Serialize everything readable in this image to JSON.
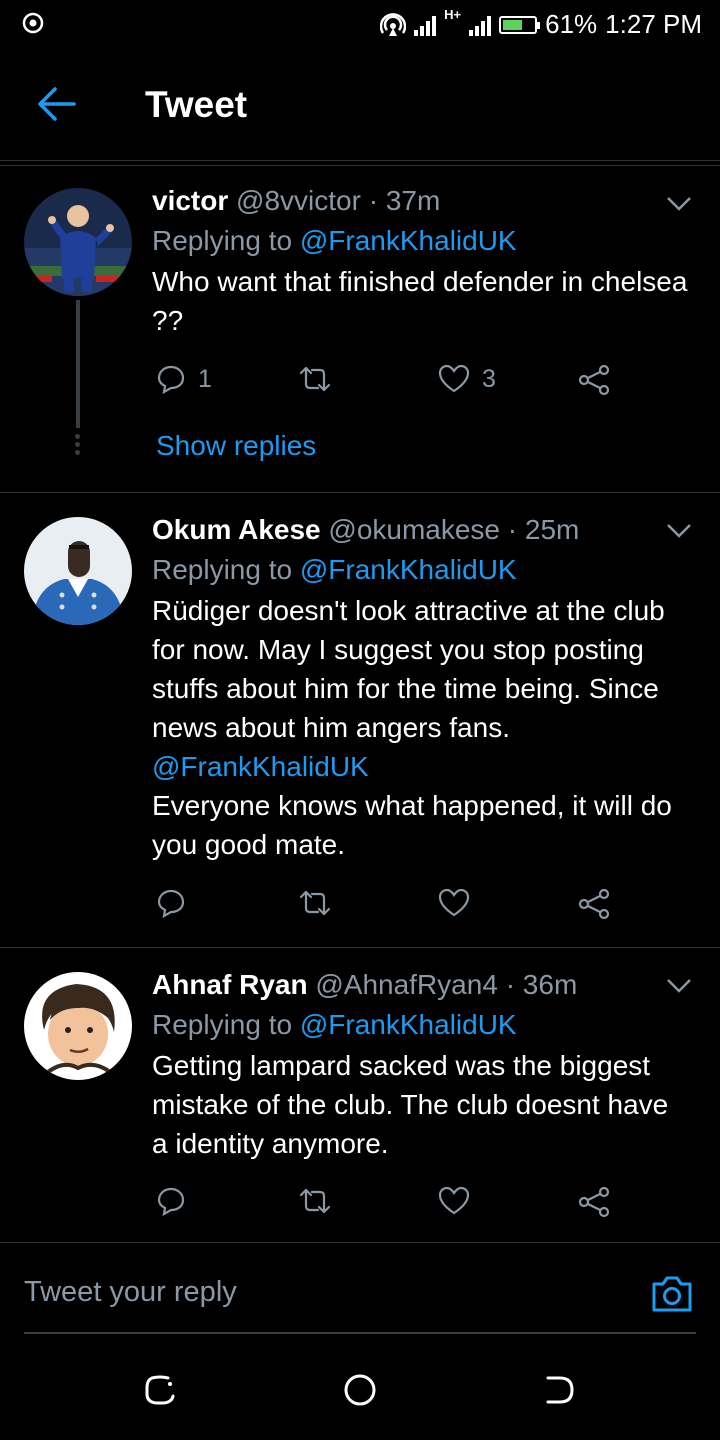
{
  "status_bar": {
    "battery": "61%",
    "time": "1:27 PM",
    "network": "H+",
    "icons": [
      "app-notification-icon",
      "hotspot-icon",
      "signal-icon",
      "battery-charging-icon"
    ]
  },
  "header": {
    "title": "Tweet",
    "back_icon": "arrow-left-icon"
  },
  "tweets": [
    {
      "name": "victor",
      "handle": "@8vvictor",
      "sep": "·",
      "time": "37m",
      "replying_prefix": "Replying to",
      "replying_to": "@FrankKhalidUK",
      "text": "Who want that finished defender in chelsea ??",
      "replies": "1",
      "retweets": "",
      "likes": "3",
      "show_replies": "Show replies"
    },
    {
      "name": "Okum Akese",
      "handle": "@okumakese",
      "sep": "·",
      "time": "25m",
      "replying_prefix": "Replying to",
      "replying_to": "@FrankKhalidUK",
      "text_part1": "Rüdiger doesn't look attractive at the club for now. May I suggest you stop posting stuffs about him for the time being. Since news about him angers fans.",
      "text_mention": "@FrankKhalidUK",
      "text_part2": "Everyone knows what happened,  it will do you good mate.",
      "replies": "",
      "retweets": "",
      "likes": ""
    },
    {
      "name": "Ahnaf Ryan",
      "handle": "@AhnafRyan4",
      "sep": "·",
      "time": "36m",
      "replying_prefix": "Replying to",
      "replying_to": "@FrankKhalidUK",
      "text": "Getting lampard sacked was the biggest mistake of the club. The club doesnt have a identity anymore.",
      "replies": "",
      "retweets": "",
      "likes": ""
    }
  ],
  "reply_bar": {
    "placeholder": "Tweet your reply",
    "camera_icon": "camera-icon"
  },
  "nav_bar": {
    "icons": [
      "recents-icon",
      "home-icon",
      "back-icon"
    ]
  },
  "colors": {
    "accent": "#1d9bf0",
    "background": "#000000",
    "muted": "#8b98a5"
  }
}
